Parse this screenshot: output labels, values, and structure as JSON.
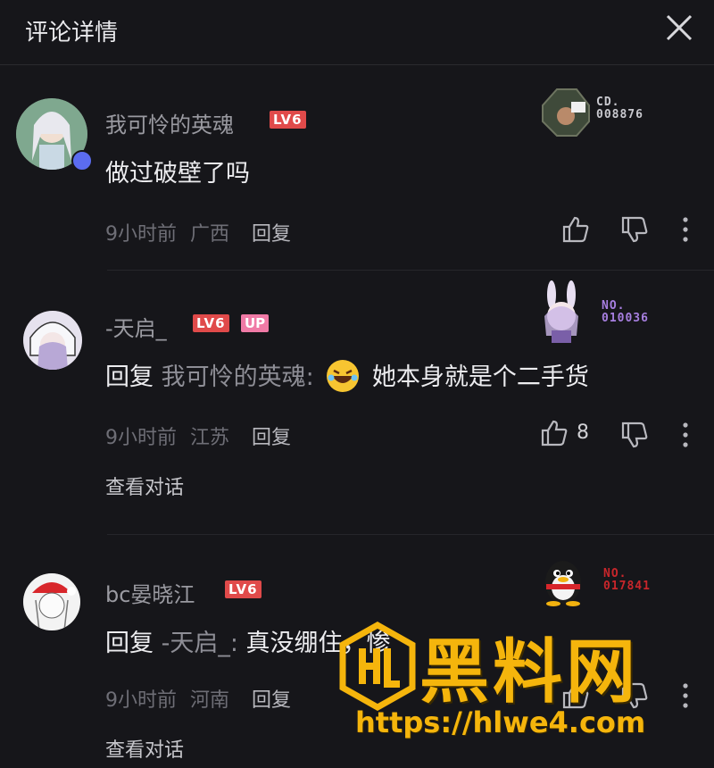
{
  "header": {
    "title": "评论详情"
  },
  "comments": [
    {
      "username": "我可怜的英魂",
      "level": "LV6",
      "content": "做过破壁了吗",
      "time": "9小时前",
      "location": "广西",
      "reply_label": "回复",
      "badge_prefix": "CD.",
      "badge_number": "008876"
    },
    {
      "username": "-天启_",
      "level": "LV6",
      "up_tag": "UP",
      "reply_prefix": "回复",
      "reply_to": "我可怜的英魂:",
      "content": "她本身就是个二手货",
      "time": "9小时前",
      "location": "江苏",
      "reply_label": "回复",
      "like_count": "8",
      "view_conversation": "查看对话",
      "badge_prefix": "NO.",
      "badge_number": "010036"
    },
    {
      "username": "bc晏晓江",
      "level": "LV6",
      "reply_prefix": "回复",
      "reply_to": "-天启_:",
      "content": "真没绷住，惨",
      "time": "9小时前",
      "location": "河南",
      "reply_label": "回复",
      "view_conversation": "查看对话",
      "badge_prefix": "NO.",
      "badge_number": "017841"
    }
  ],
  "watermark": {
    "text": "黑料网",
    "url": "https://hlwe4.com"
  },
  "colors": {
    "background": "#16161a",
    "level_red": "#e04a4a",
    "up_pink": "#f07aa6",
    "watermark_yellow": "#f5b50c",
    "badge_purple": "#a77fe0"
  }
}
